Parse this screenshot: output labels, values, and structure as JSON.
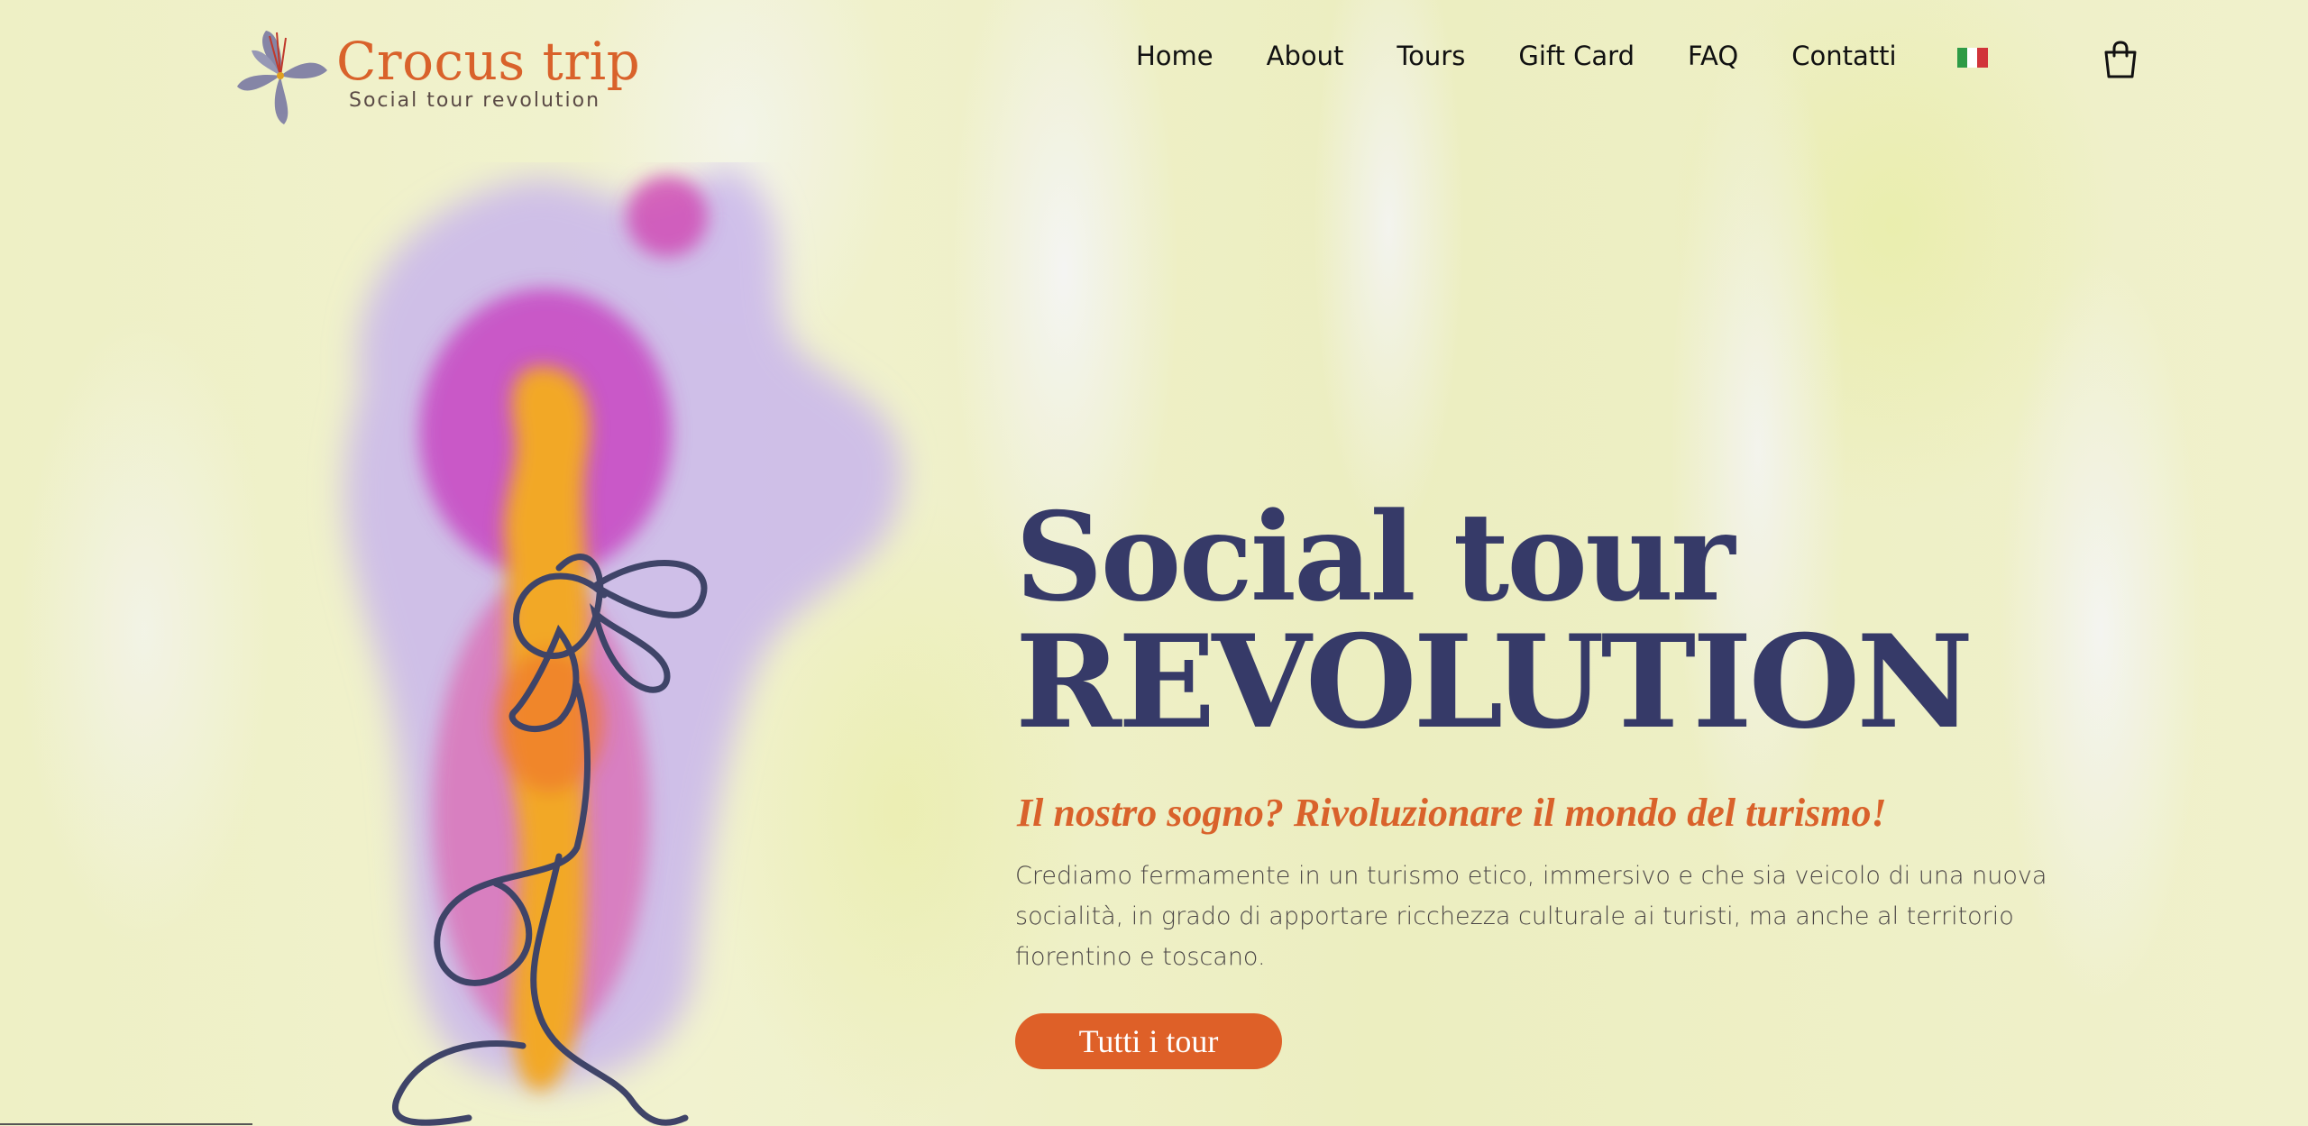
{
  "brand": {
    "title": "Crocus trip",
    "subtitle": "Social tour revolution",
    "logo_icon": "crocus-flower-icon"
  },
  "nav": {
    "items": [
      {
        "label": "Home"
      },
      {
        "label": "About"
      },
      {
        "label": "Tours"
      },
      {
        "label": "Gift Card"
      },
      {
        "label": "FAQ"
      },
      {
        "label": "Contatti"
      }
    ],
    "language_icon": "italian-flag-icon",
    "cart_icon": "shopping-bag-icon"
  },
  "hero": {
    "title_line1": "Social tour",
    "title_line2": "REVOLUTION",
    "subtitle": "Il nostro sogno? Rivoluzionare il mondo del turismo!",
    "body": "Crediamo fermamente in un turismo etico, immersivo e che sia veicolo di una nuova socialità, in grado di apportare ricchezza culturale ai turisti, ma anche al territorio fiorentino e toscano.",
    "cta_label": "Tutti i tour"
  },
  "colors": {
    "accent": "#de6028",
    "title": "#363a68",
    "background": "#eef0c9",
    "flag_green": "#2e9b47",
    "flag_white": "#ffffff",
    "flag_red": "#d1343a"
  }
}
